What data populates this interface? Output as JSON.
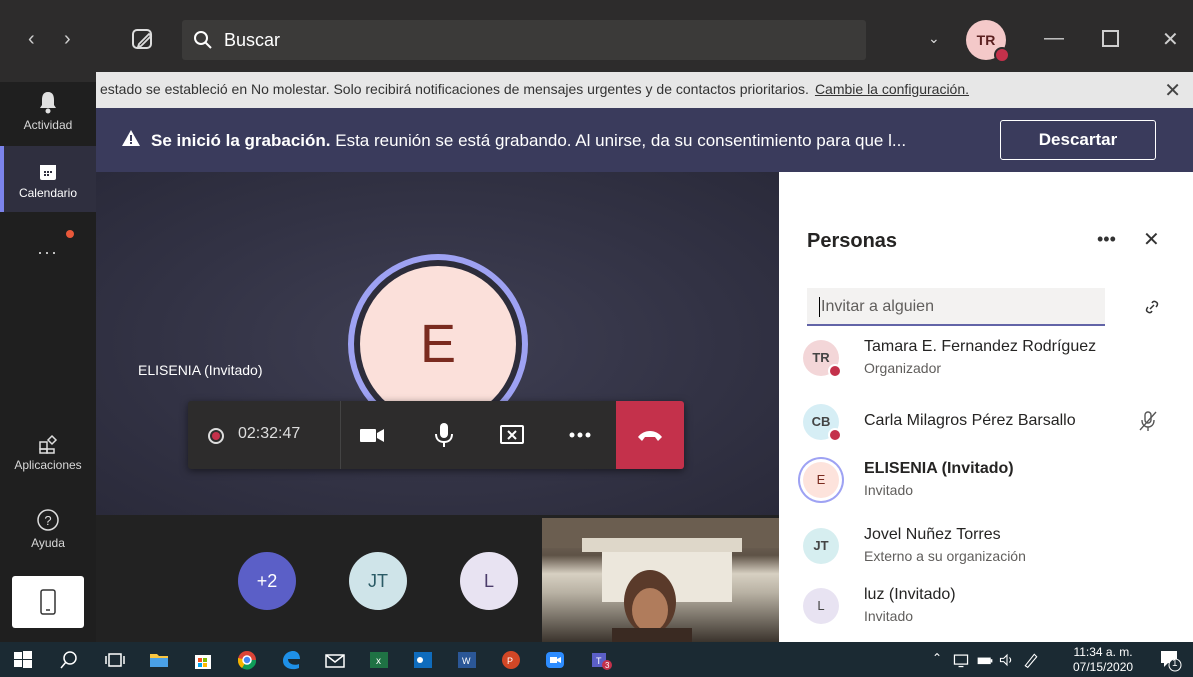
{
  "topbar": {
    "search_placeholder": "Buscar",
    "user_initials": "TR"
  },
  "rail": {
    "items": [
      {
        "label": "Actividad"
      },
      {
        "label": "Calendario"
      },
      {
        "label": "..."
      },
      {
        "label": "Aplicaciones"
      },
      {
        "label": "Ayuda"
      }
    ]
  },
  "notification": {
    "text": "estado se estableció en No molestar. Solo recibirá notificaciones de mensajes urgentes y de contactos prioritarios.",
    "link": "Cambie la configuración."
  },
  "recording": {
    "title": "Se inició la grabación.",
    "message": "Esta reunión se está grabando. Al unirse, da su consentimiento para que l...",
    "dismiss": "Descartar"
  },
  "stage": {
    "main_initial": "E",
    "main_name": "ELISENIA (Invitado)",
    "timer": "02:32:47",
    "others": [
      {
        "label": "+2",
        "color": "#5b5fc7"
      },
      {
        "label": "JT",
        "color": "#cfe4e9"
      },
      {
        "label": "L",
        "color": "#e8e3f2"
      }
    ]
  },
  "panel": {
    "title": "Personas",
    "invite_placeholder": "Invitar a alguien",
    "people": [
      {
        "initials": "TR",
        "name": "Tamara E. Fernandez Rodríguez",
        "role": "Organizador",
        "bg": "#f3d6d8"
      },
      {
        "initials": "CB",
        "name": "Carla Milagros Pérez Barsallo",
        "role": "",
        "bg": "#d6eef5"
      },
      {
        "initials": "E",
        "name": "ELISENIA (Invitado)",
        "role": "Invitado",
        "bg": "#fde3dc"
      },
      {
        "initials": "JT",
        "name": "Jovel Nuñez Torres",
        "role": "Externo a su organización",
        "bg": "#d6eef0"
      },
      {
        "initials": "L",
        "name": "luz (Invitado)",
        "role": "Invitado",
        "bg": "#e8e3f2"
      }
    ]
  },
  "taskbar": {
    "time": "11:34 a. m.",
    "date": "07/15/2020",
    "notifications": "1"
  }
}
